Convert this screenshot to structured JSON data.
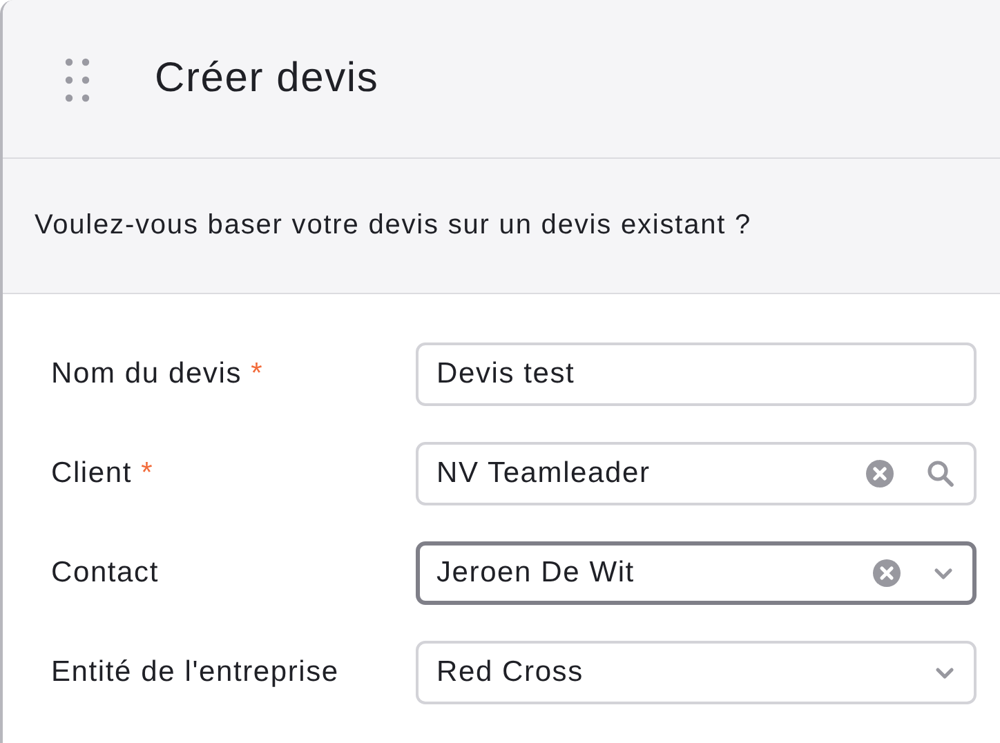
{
  "dialog": {
    "title": "Créer devis"
  },
  "prompt": "Voulez-vous baser votre devis sur un devis existant ?",
  "fields": [
    {
      "label": "Nom du devis",
      "required_mark": "*",
      "kind": "text",
      "value": "Devis test",
      "focused": false,
      "clearable": false
    },
    {
      "label": "Client",
      "required_mark": "*",
      "kind": "search",
      "value": "NV Teamleader",
      "focused": false,
      "clearable": true
    },
    {
      "label": "Contact",
      "kind": "select",
      "value": "Jeroen De Wit",
      "focused": true,
      "clearable": true
    },
    {
      "label": "Entité de l'entreprise",
      "kind": "select",
      "value": "Red Cross",
      "focused": false,
      "clearable": false
    }
  ]
}
